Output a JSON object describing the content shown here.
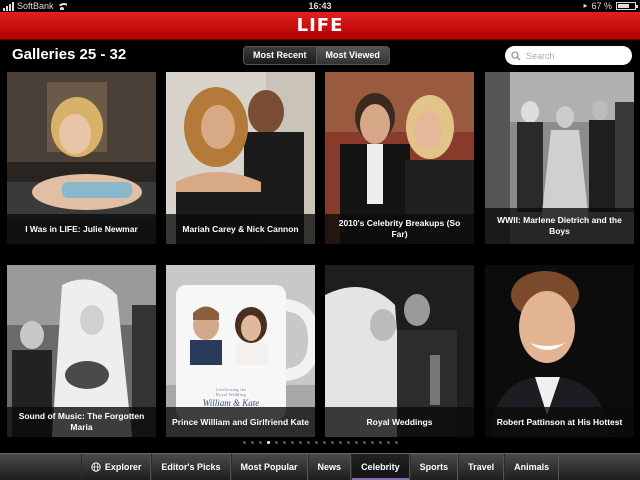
{
  "status": {
    "carrier": "SoftBank",
    "time": "16:43",
    "battery": "67 %",
    "battery_level": 0.67
  },
  "app": {
    "logo": "LIFE",
    "accent": "#cc0000"
  },
  "header": {
    "title": "Galleries 25 - 32",
    "segments": [
      "Most Recent",
      "Most Viewed"
    ],
    "search_placeholder": "Search"
  },
  "galleries": [
    {
      "caption": "I Was in LIFE: Julie Newmar"
    },
    {
      "caption": "Mariah Carey & Nick Cannon"
    },
    {
      "caption": "2010's Celebrity Breakups (So Far)"
    },
    {
      "caption": "WWII: Marlene Dietrich and the Boys"
    },
    {
      "caption": "Sound of Music: The Forgotten Maria"
    },
    {
      "caption": "Prince William and Girlfriend Kate"
    },
    {
      "caption": "Royal Weddings"
    },
    {
      "caption": "Robert Pattinson at His Hottest"
    }
  ],
  "mug": {
    "line1": "Celebrating the",
    "line2": "Royal Wedding",
    "script": "William & Kate"
  },
  "pager": {
    "total": 20,
    "current": 4
  },
  "tabs": [
    {
      "label": "Explorer",
      "icon": "globe-icon"
    },
    {
      "label": "Editor's Picks"
    },
    {
      "label": "Most Popular"
    },
    {
      "label": "News"
    },
    {
      "label": "Celebrity",
      "active": true
    },
    {
      "label": "Sports"
    },
    {
      "label": "Travel"
    },
    {
      "label": "Animals"
    }
  ]
}
